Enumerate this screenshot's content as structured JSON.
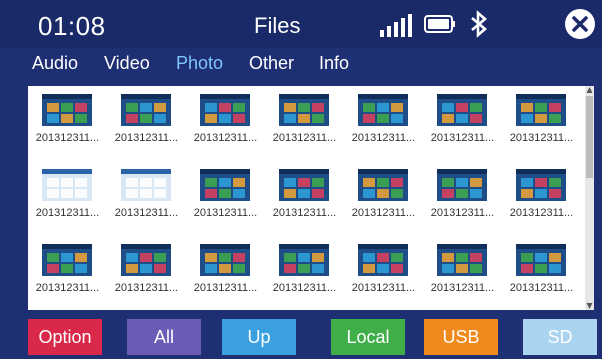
{
  "status": {
    "time": "01:08",
    "title": "Files",
    "signal_icon": "signal-bars-icon",
    "battery_icon": "battery-icon",
    "bluetooth_icon": "bluetooth-icon",
    "close_icon": "close-icon"
  },
  "tabs": [
    {
      "label": "Audio",
      "active": false
    },
    {
      "label": "Video",
      "active": false
    },
    {
      "label": "Photo",
      "active": true
    },
    {
      "label": "Other",
      "active": false
    },
    {
      "label": "Info",
      "active": false
    }
  ],
  "files": [
    {
      "name": "201312311..."
    },
    {
      "name": "201312311..."
    },
    {
      "name": "201312311..."
    },
    {
      "name": "201312311..."
    },
    {
      "name": "201312311..."
    },
    {
      "name": "201312311..."
    },
    {
      "name": "201312311..."
    },
    {
      "name": "201312311..."
    },
    {
      "name": "201312311..."
    },
    {
      "name": "201312311..."
    },
    {
      "name": "201312311..."
    },
    {
      "name": "201312311..."
    },
    {
      "name": "201312311..."
    },
    {
      "name": "201312311..."
    },
    {
      "name": "201312311..."
    },
    {
      "name": "201312311..."
    },
    {
      "name": "201312311..."
    },
    {
      "name": "201312311..."
    },
    {
      "name": "201312311..."
    },
    {
      "name": "201312311..."
    },
    {
      "name": "201312311..."
    }
  ],
  "buttons": [
    {
      "label": "Option",
      "color": "#d9284a"
    },
    {
      "label": "All",
      "color": "#6b5cb5"
    },
    {
      "label": "Up",
      "color": "#3aa0e0"
    },
    {
      "label": "Local",
      "color": "#3fae49"
    },
    {
      "label": "USB",
      "color": "#f08a1c"
    },
    {
      "label": "SD",
      "color": "#a9d3ef"
    }
  ],
  "colors": {
    "background": "#1e2f73",
    "active_tab": "#7fc4ff"
  }
}
